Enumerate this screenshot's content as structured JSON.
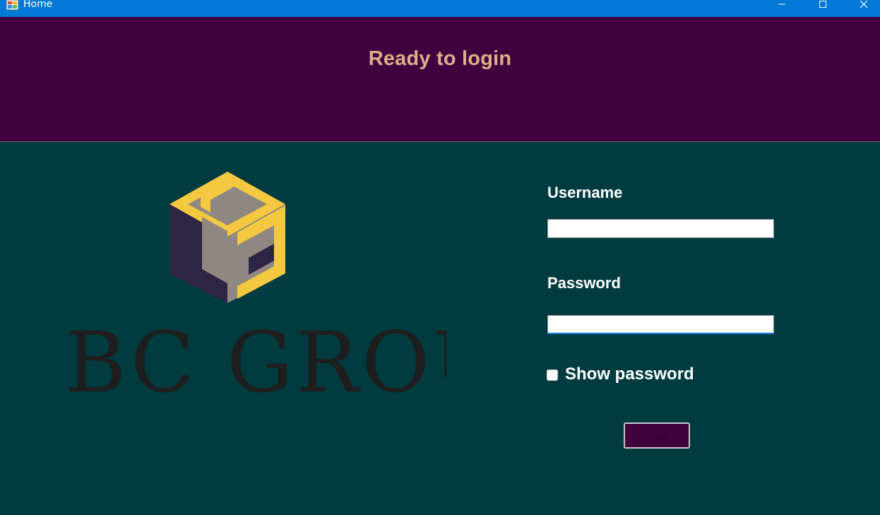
{
  "window": {
    "title": "Home",
    "icons": [
      "app-icon",
      "minimize-icon",
      "maximize-icon",
      "close-icon"
    ]
  },
  "header": {
    "status": "Ready to login"
  },
  "branding": {
    "logo_text": "BC GROUI"
  },
  "form": {
    "username_label": "Username",
    "username_value": "",
    "password_label": "Password",
    "password_value": "",
    "show_password_label": "Show password",
    "show_password_checked": false,
    "login_label": "Login"
  },
  "colors": {
    "titlebar": "#0078d4",
    "header_bg": "#41003e",
    "header_text": "#dcb088",
    "main_bg": "#003c3f",
    "logo_yellow": "#f5c842",
    "logo_purple": "#2e2444",
    "logo_gray": "#8f8880"
  }
}
